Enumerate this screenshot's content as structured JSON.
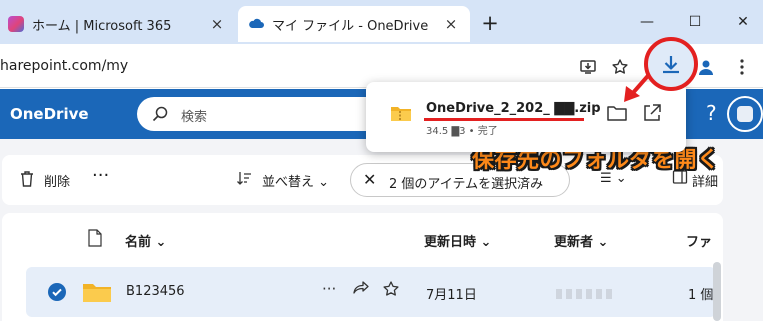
{
  "browser": {
    "tabs": [
      {
        "title": "ホーム | Microsoft 365",
        "active": false
      },
      {
        "title": "マイ ファイル - OneDrive",
        "active": true
      }
    ],
    "close_glyph": "×",
    "newtab_glyph": "+",
    "window_controls": {
      "minimize": "—",
      "maximize": "☐",
      "close": "✕"
    },
    "url": "harepoint.com/my"
  },
  "onedrive": {
    "brand": "OneDrive",
    "search_placeholder": "検索",
    "help_glyph": "?"
  },
  "download_popup": {
    "filename": "OneDrive_2_202_ ▇▇.zip",
    "meta": "34.5 ▇3 • 完了"
  },
  "callout": "保存先のフォルダを開く",
  "commandbar": {
    "delete": "削除",
    "more": "···",
    "sort": "並べ替え ⌄",
    "chip": "2 個のアイテムを選択済み",
    "view": "☰ ⌄",
    "details": "詳細"
  },
  "list": {
    "columns": {
      "name": "名前 ⌄",
      "modified": "更新日時 ⌄",
      "modified_by": "更新者 ⌄",
      "size": "ファ"
    },
    "rows": [
      {
        "name": "B123456",
        "date": "7月11日",
        "count": "1 個"
      }
    ]
  },
  "colors": {
    "accent": "#1b67b8",
    "highlight": "#e32020",
    "callout": "#ff8a1a"
  }
}
